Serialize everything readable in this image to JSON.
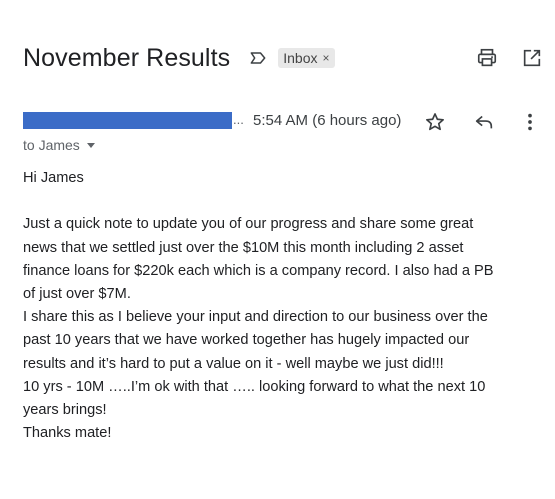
{
  "email": {
    "subject": "November Results",
    "label_chip": "Inbox",
    "label_chip_close": "×",
    "sender_ellipsis": "...",
    "timestamp": "5:54 AM (6 hours ago)",
    "recipient": "to James",
    "greeting": "Hi James",
    "body_lines": [
      "Just a quick note to update you of our progress and share some great",
      "news that we settled just over the $10M this month including 2 asset",
      "finance loans for $220k each which is a company record. I also had a PB",
      "of just over $7M.",
      "I share this as I believe your input and direction to our business over the",
      "past 10 years that we have worked together has hugely impacted our",
      "results and it’s hard to put a value on it - well maybe we just did!!!",
      "10 yrs - 10M …..I’m ok with that ….. looking forward to what the next 10",
      "years brings!",
      "Thanks mate!"
    ]
  },
  "icons": {
    "label": "label-important-icon",
    "print": "print-icon",
    "popout": "open-in-new-window-icon",
    "star": "star-icon",
    "reply": "reply-icon",
    "more": "more-vert-icon",
    "recipient_caret": "caret-down-icon"
  },
  "colors": {
    "sender_redaction": "#3b6cc7",
    "chip_background": "#e8e8e8"
  }
}
